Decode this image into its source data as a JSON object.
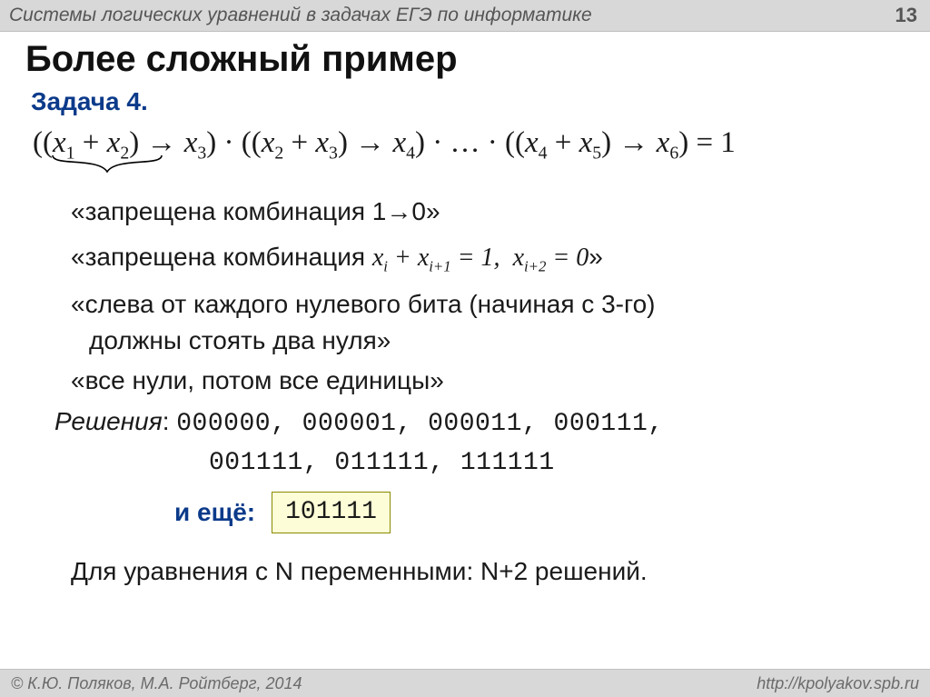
{
  "topbar": {
    "title": "Системы логических уравнений в задачах ЕГЭ по информатике",
    "page": "13"
  },
  "heading": "Более сложный пример",
  "task_label": "Задача 4.",
  "equation_html": "((<span class='x'>x</span><sub>1</sub> + <span class='x'>x</span><sub>2</sub>) → <span class='x'>x</span><sub>3</sub>) · ((<span class='x'>x</span><sub>2</sub> + <span class='x'>x</span><sub>3</sub>) → <span class='x'>x</span><sub>4</sub>) · … · ((<span class='x'>x</span><sub>4</sub> + <span class='x'>x</span><sub>5</sub>) → <span class='x'>x</span><sub>6</sub>) = 1",
  "lines": {
    "forbidden1": "«запрещена комбинация 1→0»",
    "forbidden2_prefix": "«запрещена комбинация  ",
    "forbidden2_math": "<span class='x'>x</span><sub>i</sub> + <span class='x'>x</span><sub>i+1</sub> = 1,&nbsp;&nbsp;<span class='x'>x</span><sub>i+2</sub> = 0",
    "forbidden2_suffix": "»",
    "zerobit1": "«слева от каждого нулевого бита (начиная с 3-го)",
    "zerobit2": "должны стоять два нуля»",
    "allzeros": "«все нули, потом все единицы»",
    "solutions_label": "Решения",
    "solutions_row1": "000000, 000001, 000011, 000111,",
    "solutions_row2": "001111, 011111, 111111",
    "andmore_label": "и ещё",
    "andmore_value": "101111",
    "general": "Для уравнения с N переменными: N+2 решений."
  },
  "footer": {
    "left": "© К.Ю. Поляков, М.А. Ройтберг, 2014",
    "right": "http://kpolyakov.spb.ru"
  }
}
